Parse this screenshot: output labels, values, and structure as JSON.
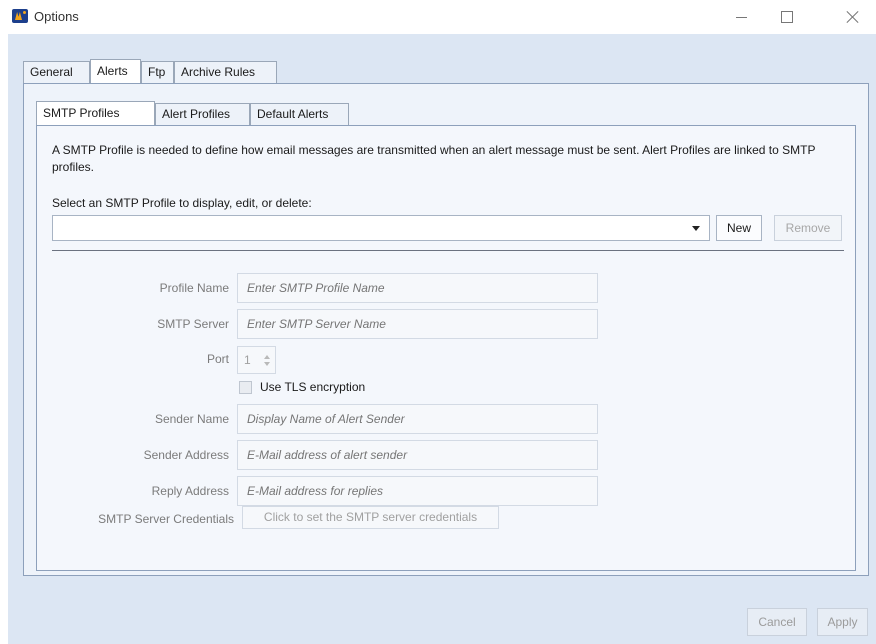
{
  "window": {
    "title": "Options"
  },
  "top_tabs": [
    {
      "label": "General",
      "active": false
    },
    {
      "label": "Alerts",
      "active": true
    },
    {
      "label": "Ftp",
      "active": false
    },
    {
      "label": "Archive Rules",
      "active": false
    }
  ],
  "sub_tabs": [
    {
      "label": "SMTP Profiles",
      "active": true
    },
    {
      "label": "Alert Profiles",
      "active": false
    },
    {
      "label": "Default Alerts",
      "active": false
    }
  ],
  "smtp": {
    "description": "A SMTP Profile is needed to define how email messages are transmitted when an alert message must be sent. Alert Profiles are linked to SMTP profiles.",
    "select_label": "Select an SMTP Profile to display, edit, or delete:",
    "selected_profile": "",
    "new_label": "New",
    "remove_label": "Remove",
    "fields": {
      "profile_name": {
        "label": "Profile Name",
        "placeholder": "Enter SMTP Profile Name"
      },
      "smtp_server": {
        "label": "SMTP Server",
        "placeholder": "Enter SMTP Server Name"
      },
      "port": {
        "label": "Port",
        "value": "1"
      },
      "tls": {
        "label": "Use TLS encryption",
        "checked": false
      },
      "sender_name": {
        "label": "Sender Name",
        "placeholder": "Display Name of Alert Sender"
      },
      "sender_address": {
        "label": "Sender Address",
        "placeholder": "E-Mail address of alert sender"
      },
      "reply_address": {
        "label": "Reply Address",
        "placeholder": "E-Mail address for replies"
      },
      "credentials": {
        "label": "SMTP Server Credentials",
        "button": "Click to set the SMTP server credentials"
      }
    }
  },
  "footer": {
    "cancel_label": "Cancel",
    "apply_label": "Apply"
  }
}
